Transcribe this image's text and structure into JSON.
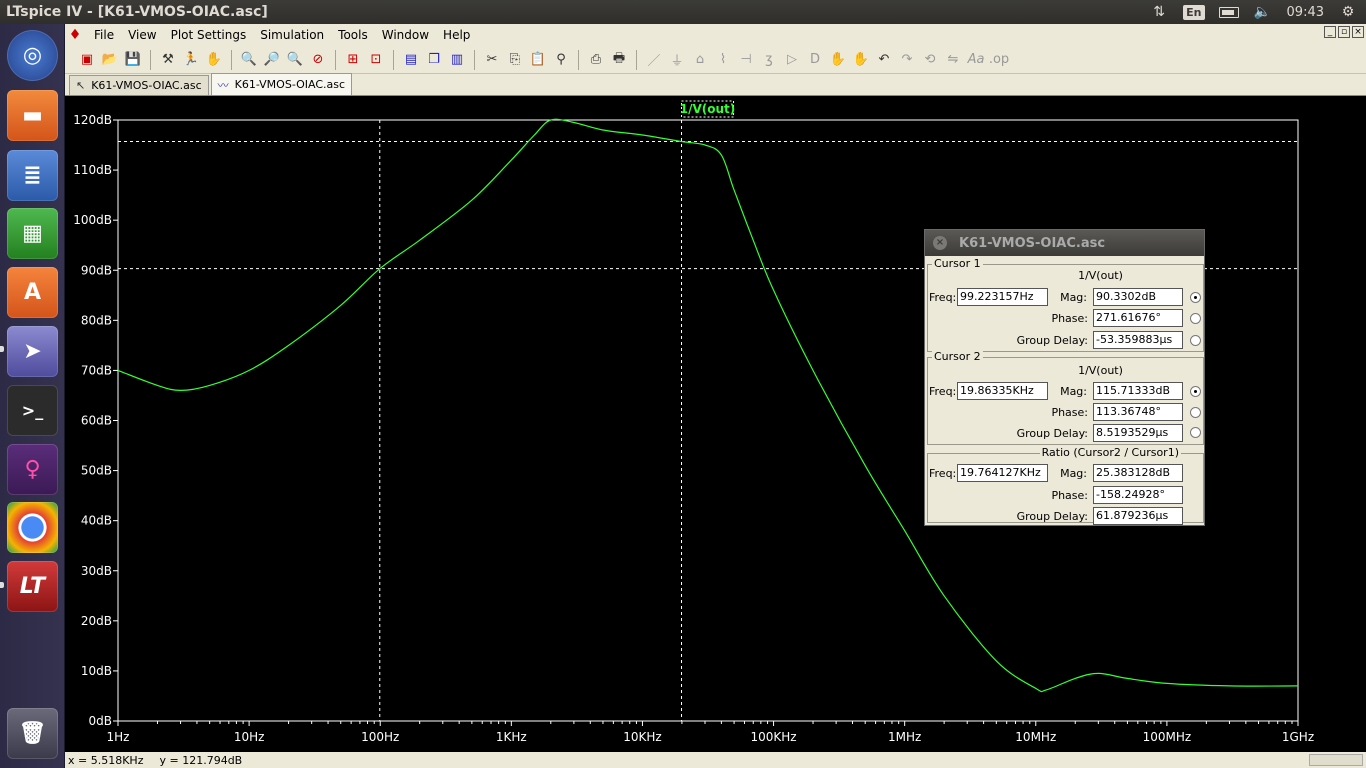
{
  "window": {
    "title": "LTspice IV - [K61-VMOS-OIAC.asc]"
  },
  "tray": {
    "keyboard": "En",
    "clock": "09:43"
  },
  "menu": [
    {
      "label": "File"
    },
    {
      "label": "View"
    },
    {
      "label": "Plot Settings"
    },
    {
      "label": "Simulation"
    },
    {
      "label": "Tools"
    },
    {
      "label": "Window"
    },
    {
      "label": "Help"
    }
  ],
  "tabs": [
    {
      "label": "K61-VMOS-OIAC.asc",
      "icon": "schematic-icon",
      "active": false
    },
    {
      "label": "K61-VMOS-OIAC.asc",
      "icon": "waveform-icon",
      "active": true
    }
  ],
  "status": {
    "x": "x = 5.518KHz",
    "y": "y = 121.794dB"
  },
  "colors": {
    "trace": "#33ff33",
    "grid": "#ffffff",
    "background": "#000000"
  },
  "chart_data": {
    "type": "line",
    "title": "1/V(out)",
    "xlabel": "",
    "ylabel": "",
    "x_scale": "log",
    "xlim": [
      1,
      1000000000
    ],
    "ylim": [
      0,
      120
    ],
    "x_ticks": [
      "1Hz",
      "10Hz",
      "100Hz",
      "1KHz",
      "10KHz",
      "100KHz",
      "1MHz",
      "10MHz",
      "100MHz",
      "1GHz"
    ],
    "y_ticks": [
      "0dB",
      "10dB",
      "20dB",
      "30dB",
      "40dB",
      "50dB",
      "60dB",
      "70dB",
      "80dB",
      "90dB",
      "100dB",
      "110dB",
      "120dB"
    ],
    "y_tick_values": [
      0,
      10,
      20,
      30,
      40,
      50,
      60,
      70,
      80,
      90,
      100,
      110,
      120
    ],
    "series": [
      {
        "name": "1/V(out)",
        "x": [
          1,
          2,
          3,
          5,
          10,
          20,
          50,
          99.2,
          200,
          500,
          1000,
          1500,
          2000,
          3000,
          5000,
          10000,
          19863,
          30000,
          40000,
          50000,
          70000,
          100000,
          200000,
          500000,
          1000000,
          2000000,
          5000000,
          10000000,
          12000000,
          20000000,
          30000000,
          50000000,
          100000000,
          300000000,
          1000000000
        ],
        "y": [
          70,
          67,
          66,
          67,
          70,
          75,
          83,
          90.3,
          96,
          104,
          112,
          117,
          120,
          119.5,
          118,
          117,
          115.7,
          115,
          113,
          106,
          96,
          86,
          70,
          51,
          38,
          25,
          12,
          6.5,
          6.2,
          8.5,
          9.5,
          8.5,
          7.5,
          7,
          7
        ]
      }
    ],
    "cursors": [
      {
        "label": "Cursor 1",
        "x": 99.223157,
        "y": 90.3302
      },
      {
        "label": "Cursor 2",
        "x": 19863.35,
        "y": 115.71333
      }
    ]
  },
  "cursor_dialog": {
    "title": "K61-VMOS-OIAC.asc",
    "cursor1": {
      "group": "Cursor 1",
      "trace": "1/V(out)",
      "freq_label": "Freq:",
      "freq": "99.223157Hz",
      "mag_label": "Mag:",
      "mag": "90.3302dB",
      "phase_label": "Phase:",
      "phase": "271.61676°",
      "gd_label": "Group Delay:",
      "gd": "-53.359883µs"
    },
    "cursor2": {
      "group": "Cursor 2",
      "trace": "1/V(out)",
      "freq_label": "Freq:",
      "freq": "19.86335KHz",
      "mag_label": "Mag:",
      "mag": "115.71333dB",
      "phase_label": "Phase:",
      "phase": "113.36748°",
      "gd_label": "Group Delay:",
      "gd": "8.5193529µs"
    },
    "ratio": {
      "group": "Ratio (Cursor2 / Cursor1)",
      "freq_label": "Freq:",
      "freq": "19.764127KHz",
      "mag_label": "Mag:",
      "mag": "25.383128dB",
      "phase_label": "Phase:",
      "phase": "-158.24928°",
      "gd_label": "Group Delay:",
      "gd": "61.879236µs"
    }
  }
}
